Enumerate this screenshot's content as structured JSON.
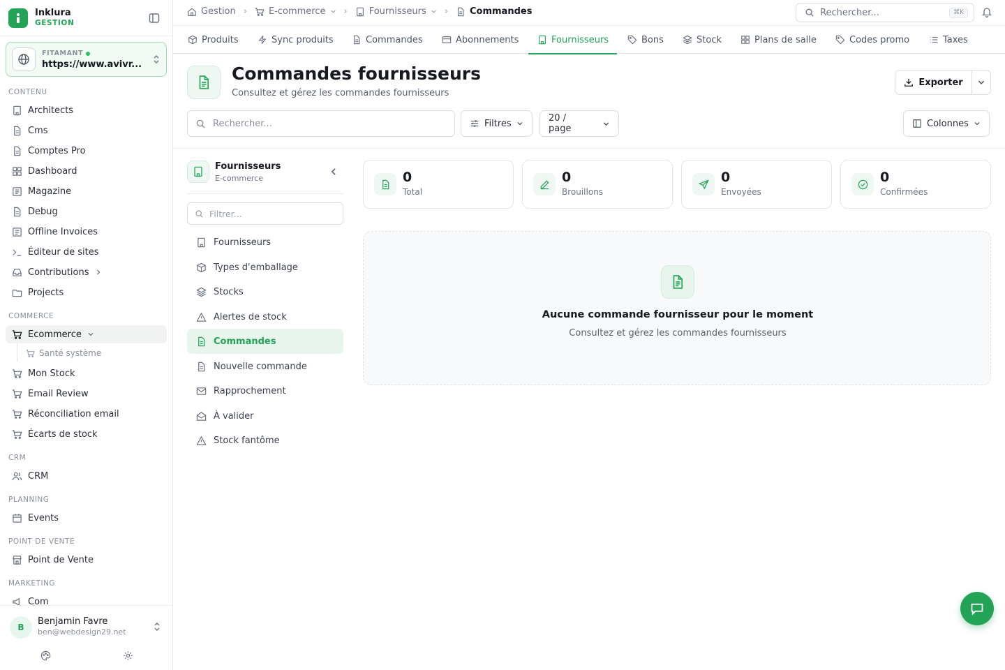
{
  "brand": {
    "name": "Inklura",
    "subtitle": "GESTION"
  },
  "site": {
    "tag": "FITAMANT",
    "url": "https://www.avivr..."
  },
  "sidebar": {
    "sections": {
      "contenu": "CONTENU",
      "commerce": "COMMERCE",
      "crm": "CRM",
      "planning": "PLANNING",
      "pos": "POINT DE VENTE",
      "marketing": "MARKETING"
    },
    "contenu_items": [
      "Architects",
      "Cms",
      "Comptes Pro",
      "Dashboard",
      "Magazine",
      "Debug",
      "Offline Invoices",
      "Éditeur de sites",
      "Contributions",
      "Projects"
    ],
    "commerce_items": {
      "ecommerce": "Ecommerce",
      "sante": "Santé système",
      "stock": "Mon Stock",
      "email_review": "Email Review",
      "reconciliation": "Réconciliation email",
      "ecarts": "Écarts de stock"
    },
    "crm_item": "CRM",
    "planning_item": "Events",
    "pos_item": "Point de Vente",
    "marketing_item": "Com"
  },
  "user": {
    "initial": "B",
    "name": "Benjamin Favre",
    "email": "ben@webdesign29.net"
  },
  "breadcrumb": {
    "home": "Gestion",
    "ecommerce": "E-commerce",
    "fournisseurs": "Fournisseurs",
    "current": "Commandes"
  },
  "top_search": {
    "placeholder": "Rechercher...",
    "shortcut": "⌘K"
  },
  "tabs": [
    "Produits",
    "Sync produits",
    "Commandes",
    "Abonnements",
    "Fournisseurs",
    "Bons",
    "Stock",
    "Plans de salle",
    "Codes promo",
    "Taxes"
  ],
  "page": {
    "title": "Commandes fournisseurs",
    "subtitle": "Consultez et gérez les commandes fournisseurs",
    "export_label": "Exporter",
    "search_placeholder": "Rechercher...",
    "filters_label": "Filtres",
    "per_page_label": "20 / page",
    "columns_label": "Colonnes"
  },
  "subnav": {
    "title": "Fournisseurs",
    "subtitle": "E-commerce",
    "filter_placeholder": "Filtrer...",
    "items": [
      "Fournisseurs",
      "Types d'emballage",
      "Stocks",
      "Alertes de stock",
      "Commandes",
      "Nouvelle commande",
      "Rapprochement",
      "À valider",
      "Stock fantôme"
    ]
  },
  "stats": [
    {
      "value": "0",
      "label": "Total"
    },
    {
      "value": "0",
      "label": "Brouillons"
    },
    {
      "value": "0",
      "label": "Envoyées"
    },
    {
      "value": "0",
      "label": "Confirmées"
    }
  ],
  "empty": {
    "title": "Aucune commande fournisseur pour le moment",
    "subtitle": "Consultez et gérez les commandes fournisseurs"
  },
  "colors": {
    "accent": "#22a356",
    "accent_light": "#e8f5ed"
  }
}
